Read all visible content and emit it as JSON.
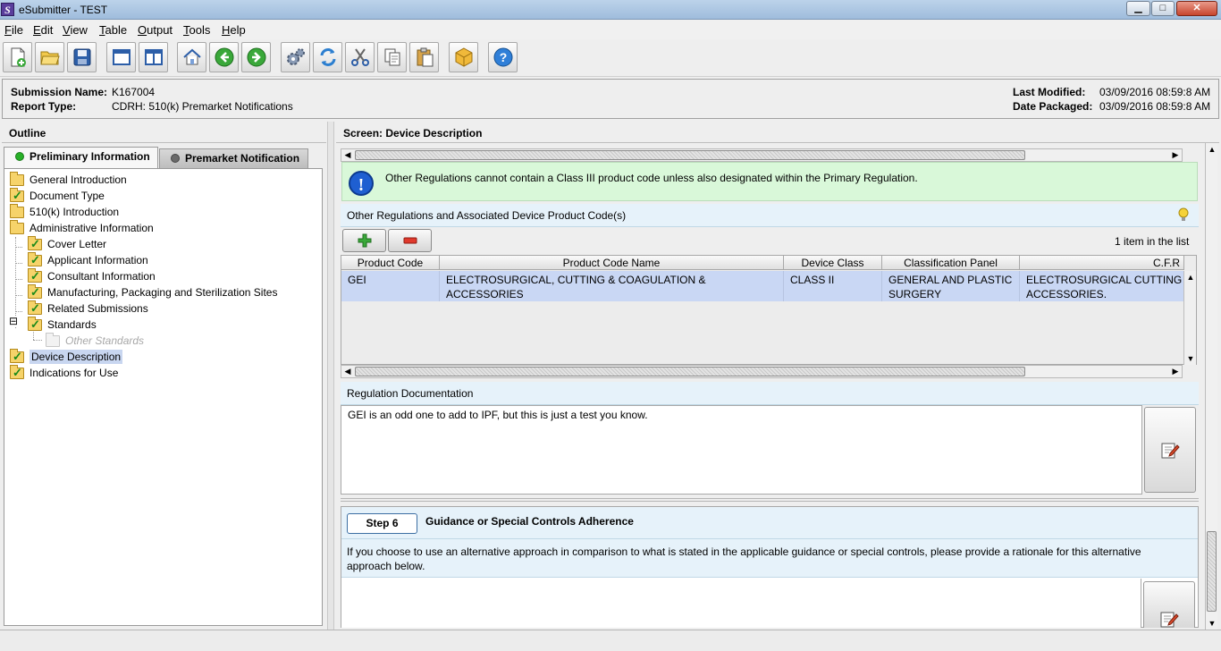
{
  "window": {
    "title": "eSubmitter - TEST",
    "app_icon_letter": "S",
    "minimize_label": "▁",
    "maximize_label": "□",
    "close_label": "✕"
  },
  "menu": [
    "File",
    "Edit",
    "View",
    "Table",
    "Output",
    "Tools",
    "Help"
  ],
  "toolbar_icons": [
    "new-document-icon",
    "open-folder-icon",
    "save-icon",
    "window-icon",
    "split-view-icon",
    "home-icon",
    "back-arrow-icon",
    "forward-arrow-icon",
    "settings-gears-icon",
    "refresh-icon",
    "cut-icon",
    "copy-icon",
    "paste-icon",
    "package-icon",
    "help-icon"
  ],
  "submission": {
    "name_label": "Submission Name:",
    "name": "K167004",
    "report_type_label": "Report Type:",
    "report_type": "CDRH: 510(k) Premarket Notifications",
    "last_modified_label": "Last Modified:",
    "last_modified": "03/09/2016 08:59:8 AM",
    "date_packaged_label": "Date Packaged:",
    "date_packaged": "03/09/2016 08:59:8 AM"
  },
  "outline": {
    "title": "Outline",
    "tabs": [
      {
        "label": "Preliminary Information",
        "dot_color": "#28b028",
        "active": true
      },
      {
        "label": "Premarket Notification",
        "dot_color": "#6a6a6a",
        "active": false
      }
    ],
    "tree": [
      {
        "label": "General Introduction",
        "level": 0,
        "checked": false
      },
      {
        "label": "Document Type",
        "level": 0,
        "checked": true
      },
      {
        "label": "510(k) Introduction",
        "level": 0,
        "checked": false
      },
      {
        "label": "Administrative Information",
        "level": 0,
        "checked": false
      },
      {
        "label": "Cover Letter",
        "level": 1,
        "checked": true
      },
      {
        "label": "Applicant Information",
        "level": 1,
        "checked": true
      },
      {
        "label": "Consultant Information",
        "level": 1,
        "checked": true
      },
      {
        "label": "Manufacturing, Packaging and Sterilization Sites",
        "level": 1,
        "checked": true
      },
      {
        "label": "Related Submissions",
        "level": 1,
        "checked": true
      },
      {
        "label": "Standards",
        "level": 1,
        "checked": true
      },
      {
        "label": "Other Standards",
        "level": 2,
        "checked": false
      },
      {
        "label": "Device Description",
        "level": 0,
        "checked": true
      },
      {
        "label": "Indications for Use",
        "level": 0,
        "checked": true
      }
    ],
    "expander_symbol": "⊟"
  },
  "screen": {
    "title": "Screen: Device Description",
    "notice": "Other Regulations cannot contain a Class III product code unless also designated within the Primary Regulation.",
    "info_icon_glyph": "!",
    "regulations_section_title": "Other Regulations and Associated Device Product Code(s)",
    "item_count": "1 item in the list",
    "table": {
      "columns": [
        "Product Code",
        "Product Code Name",
        "Device Class",
        "Classification Panel",
        "C.F.R"
      ],
      "rows": [
        [
          "GEI",
          "ELECTROSURGICAL, CUTTING & COAGULATION & ACCESSORIES",
          "CLASS II",
          "GENERAL AND PLASTIC SURGERY",
          "ELECTROSURGICAL CUTTING ACCESSORIES."
        ]
      ]
    },
    "regulation_doc_title": "Regulation Documentation",
    "regulation_doc_text": "GEI is an odd one to add to IPF, but this is just a test you know.",
    "step_label": "Step 6",
    "step_title": "Guidance or Special Controls Adherence",
    "step_text": "If you choose to use an alternative approach in comparison to what is stated in the applicable guidance or special controls, please provide a rationale for this alternative approach below."
  },
  "scroll_arrows": {
    "left": "◀",
    "right": "▶",
    "up": "▲",
    "down": "▼"
  }
}
